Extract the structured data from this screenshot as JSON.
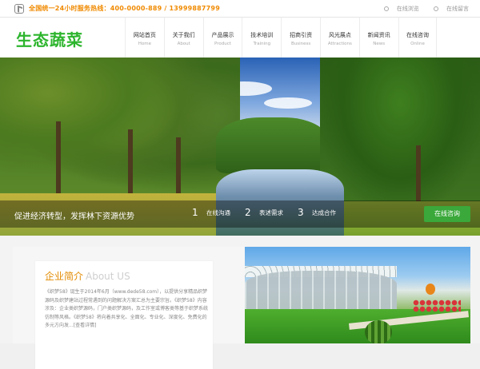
{
  "topbar": {
    "hotline": "全国统一24小时服务热线：400-0000-889 / 13999887799",
    "links": [
      "在线浏览",
      "在线留言"
    ]
  },
  "header": {
    "logo": "生态蔬菜",
    "nav": [
      {
        "cn": "网站首页",
        "en": "Home"
      },
      {
        "cn": "关于我们",
        "en": "About"
      },
      {
        "cn": "产品展示",
        "en": "Product"
      },
      {
        "cn": "技术培训",
        "en": "Training"
      },
      {
        "cn": "招商引资",
        "en": "Business"
      },
      {
        "cn": "风光展点",
        "en": "Attractions"
      },
      {
        "cn": "新闻资讯",
        "en": "News"
      },
      {
        "cn": "在线咨询",
        "en": "Online"
      }
    ]
  },
  "banner": {
    "slogan": "促进经济转型，发挥林下资源优势",
    "steps": [
      {
        "num": "1",
        "label": "在线沟通"
      },
      {
        "num": "2",
        "label": "表述需求"
      },
      {
        "num": "3",
        "label": "达成合作"
      }
    ],
    "consult_button": "在线咨询"
  },
  "about": {
    "title_cn": "企业简介",
    "title_en": "About US",
    "text": "《织梦58》诞生于2014年6月（www.dede58.com），以提供分享精品织梦源码及织梦建站过程常遇到的问题解决方案汇总为主要宗旨。《织梦58》内容涉及：企业类织梦源码，门户类织梦源码，及工作室或博客类等基于织梦系统仿制等风格。《织梦58》将向着共享化、全面化、专业化、深度化、免费化的多元方向发...[查看详情]"
  },
  "colors": {
    "accent_green": "#2db52d",
    "hotline_orange": "#f08a00",
    "button_green": "#3aa83a"
  }
}
